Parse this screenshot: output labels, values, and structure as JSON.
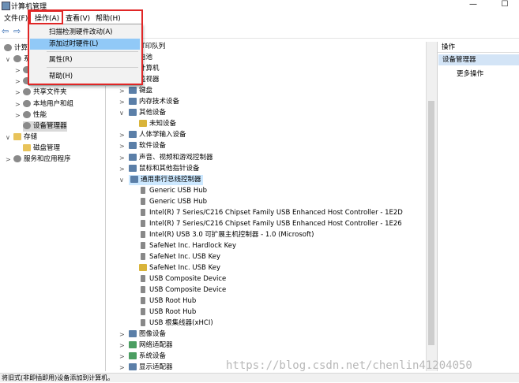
{
  "window": {
    "title": "计算机管理",
    "minimize_icon": "—",
    "maximize_icon": "☐"
  },
  "menubar": {
    "items": [
      "文件(F)",
      "操作(A)",
      "查看(V)",
      "帮助(H)"
    ]
  },
  "toolbar": {
    "back": "⇦",
    "forward": "⇨"
  },
  "dropdown": {
    "items": [
      "扫描检测硬件改动(A)",
      "添加过时硬件(L)",
      "属性(R)",
      "帮助(H)"
    ],
    "highlighted_index": 1
  },
  "left_tree": {
    "rows": [
      {
        "label": "计算机",
        "indent": 0,
        "twisty": ""
      },
      {
        "label": "系",
        "indent": 1,
        "twisty": "∨"
      },
      {
        "label": "",
        "indent": 2,
        "twisty": ">"
      },
      {
        "label": "",
        "indent": 2,
        "twisty": ">"
      },
      {
        "label": "共享文件夹",
        "indent": 2,
        "twisty": ">"
      },
      {
        "label": "本地用户和组",
        "indent": 2,
        "twisty": ">"
      },
      {
        "label": "性能",
        "indent": 2,
        "twisty": ">"
      },
      {
        "label": "设备管理器",
        "indent": 2,
        "twisty": "",
        "selected": true
      },
      {
        "label": "存储",
        "indent": 1,
        "twisty": "∨"
      },
      {
        "label": "磁盘管理",
        "indent": 2,
        "twisty": ""
      },
      {
        "label": "服务和应用程序",
        "indent": 1,
        "twisty": ">"
      }
    ]
  },
  "device_tree": {
    "rows": [
      {
        "label": "IT印队列",
        "indent": 1,
        "twisty": ""
      },
      {
        "label": "电池",
        "indent": 1,
        "twisty": ""
      },
      {
        "label": "计算机",
        "indent": 1,
        "twisty": ""
      },
      {
        "label": "监视器",
        "indent": 1,
        "twisty": ""
      },
      {
        "label": "键盘",
        "indent": 1,
        "twisty": ">"
      },
      {
        "label": "内存技术设备",
        "indent": 1,
        "twisty": ">"
      },
      {
        "label": "其他设备",
        "indent": 1,
        "twisty": "∨"
      },
      {
        "label": "未知设备",
        "indent": 2,
        "twisty": "",
        "warn": true
      },
      {
        "label": "人体学输入设备",
        "indent": 1,
        "twisty": ">"
      },
      {
        "label": "软件设备",
        "indent": 1,
        "twisty": ">"
      },
      {
        "label": "声音、视频和游戏控制器",
        "indent": 1,
        "twisty": ">"
      },
      {
        "label": "鼠标和其他指针设备",
        "indent": 1,
        "twisty": ">"
      },
      {
        "label": "通用串行总线控制器",
        "indent": 1,
        "twisty": "∨",
        "selected": true
      },
      {
        "label": "Generic USB Hub",
        "indent": 2,
        "twisty": ""
      },
      {
        "label": "Generic USB Hub",
        "indent": 2,
        "twisty": ""
      },
      {
        "label": "Intel(R) 7 Series/C216 Chipset Family USB Enhanced Host Controller - 1E2D",
        "indent": 2,
        "twisty": ""
      },
      {
        "label": "Intel(R) 7 Series/C216 Chipset Family USB Enhanced Host Controller - 1E26",
        "indent": 2,
        "twisty": ""
      },
      {
        "label": "Intel(R) USB 3.0 可扩展主机控制器 - 1.0 (Microsoft)",
        "indent": 2,
        "twisty": ""
      },
      {
        "label": "SafeNet Inc. Hardlock Key",
        "indent": 2,
        "twisty": ""
      },
      {
        "label": "SafeNet Inc. USB Key",
        "indent": 2,
        "twisty": ""
      },
      {
        "label": "SafeNet Inc. USB Key",
        "indent": 2,
        "twisty": "",
        "warn": true
      },
      {
        "label": "USB Composite Device",
        "indent": 2,
        "twisty": ""
      },
      {
        "label": "USB Composite Device",
        "indent": 2,
        "twisty": ""
      },
      {
        "label": "USB Root Hub",
        "indent": 2,
        "twisty": ""
      },
      {
        "label": "USB Root Hub",
        "indent": 2,
        "twisty": ""
      },
      {
        "label": "USB 根集线器(xHCI)",
        "indent": 2,
        "twisty": ""
      },
      {
        "label": "图像设备",
        "indent": 1,
        "twisty": ">"
      },
      {
        "label": "网络适配器",
        "indent": 1,
        "twisty": ">"
      },
      {
        "label": "系统设备",
        "indent": 1,
        "twisty": ">"
      },
      {
        "label": "显示适配器",
        "indent": 1,
        "twisty": ">"
      }
    ]
  },
  "actions_pane": {
    "header": "操作",
    "selected": "设备管理器",
    "more": "更多操作"
  },
  "statusbar": {
    "text": "将旧式(非即插即用)设备添加到计算机。"
  },
  "watermark": "https://blog.csdn.net/chenlin41204050",
  "colors": {
    "highlight_box": "#e02626",
    "menu_hover": "#91c9f7",
    "selection": "#cce8ff"
  }
}
